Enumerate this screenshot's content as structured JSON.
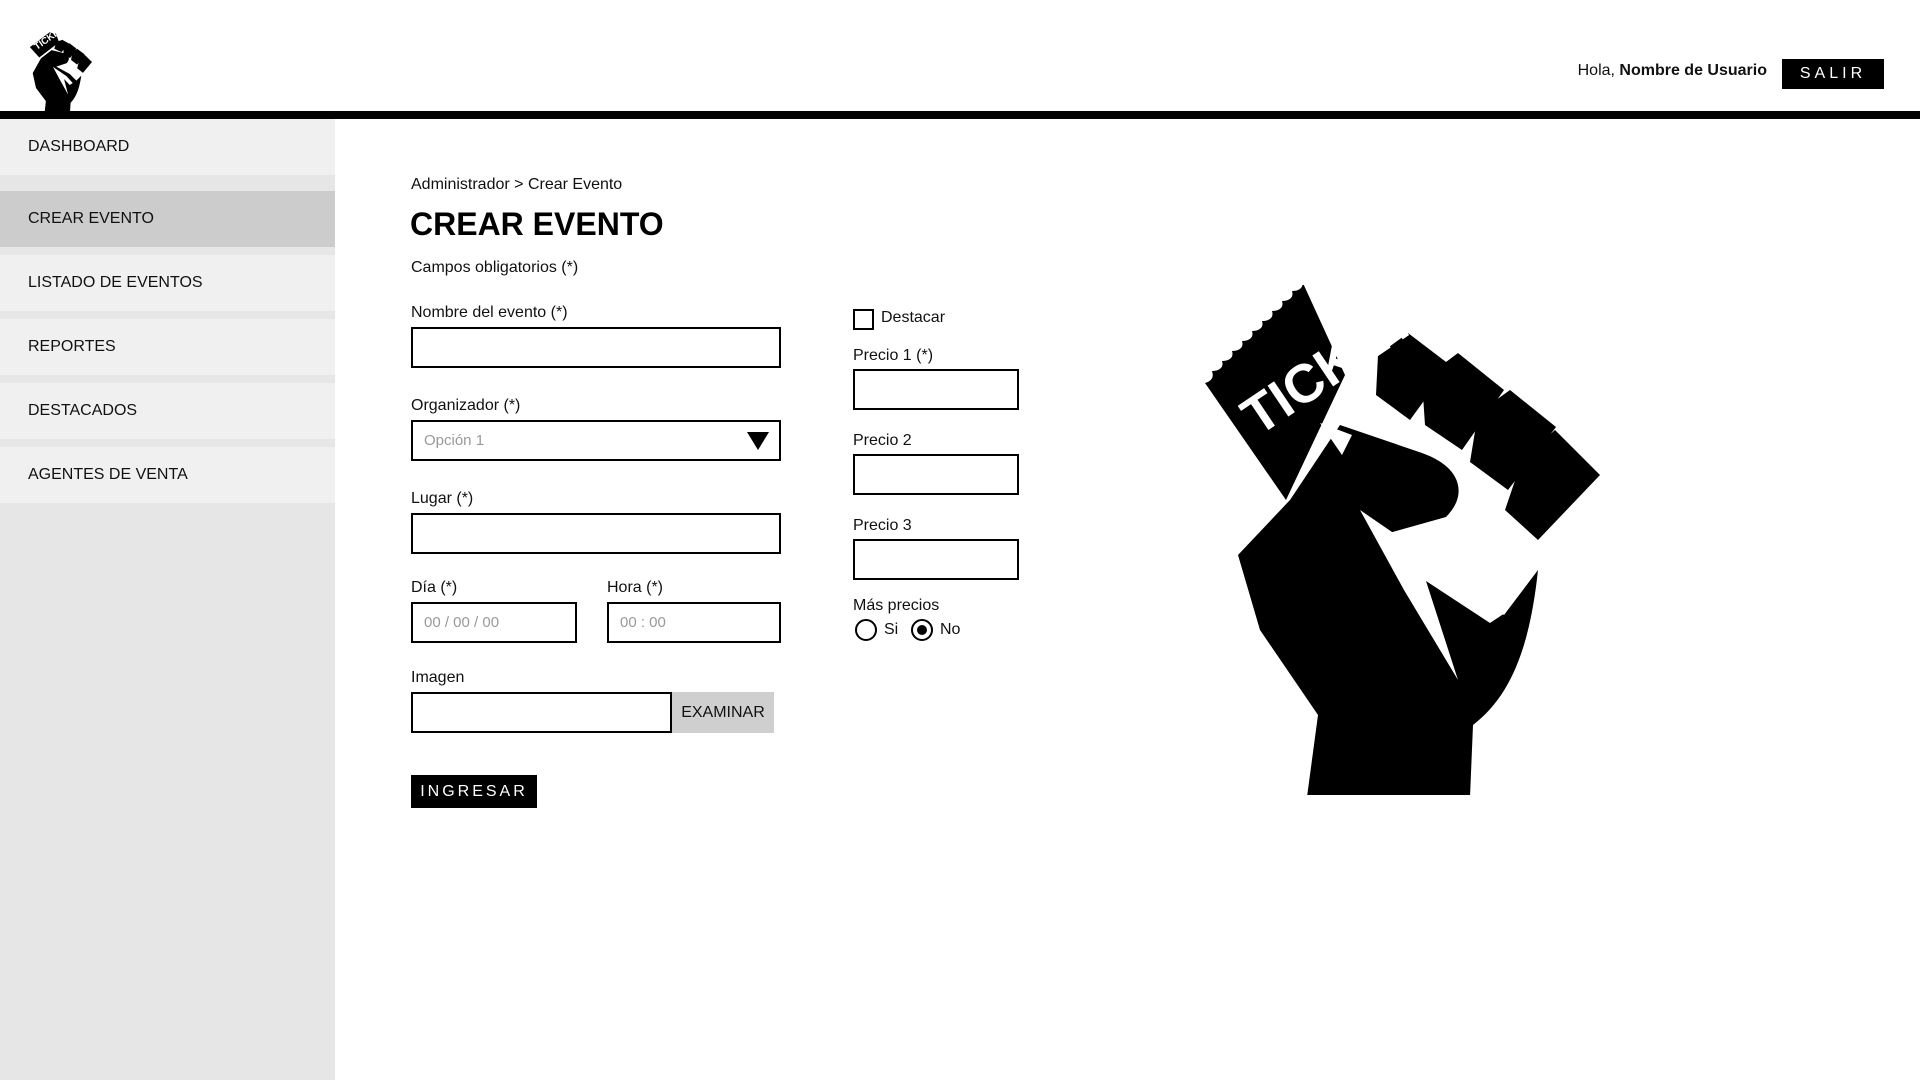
{
  "header": {
    "logo_text": "TICKET",
    "greeting_prefix": "Hola, ",
    "user_name": "Nombre de Usuario",
    "logout_label": "SALIR"
  },
  "sidebar": {
    "items": [
      {
        "label": "DASHBOARD",
        "active": false
      },
      {
        "label": "CREAR EVENTO",
        "active": true
      },
      {
        "label": "LISTADO DE EVENTOS",
        "active": false
      },
      {
        "label": "REPORTES",
        "active": false
      },
      {
        "label": "DESTACADOS",
        "active": false
      },
      {
        "label": "AGENTES DE VENTA",
        "active": false
      }
    ]
  },
  "main": {
    "breadcrumb": "Administrador > Crear Evento",
    "title": "CREAR EVENTO",
    "required_note": "Campos obligatorios (*)",
    "form": {
      "event_name_label": "Nombre del evento (*)",
      "event_name_value": "",
      "organizer_label": "Organizador (*)",
      "organizer_selected": "Opción 1",
      "place_label": "Lugar (*)",
      "place_value": "",
      "day_label": "Día (*)",
      "day_placeholder": "00 / 00 / 00",
      "time_label": "Hora (*)",
      "time_placeholder": "00 : 00",
      "image_label": "Imagen",
      "image_value": "",
      "browse_label": "EXAMINAR",
      "submit_label": "INGRESAR",
      "featured_label": "Destacar",
      "featured_checked": false,
      "price1_label": "Precio 1 (*)",
      "price2_label": "Precio 2",
      "price3_label": "Precio 3",
      "more_prices_label": "Más precios",
      "more_prices_options": [
        {
          "label": "Si",
          "selected": false
        },
        {
          "label": "No",
          "selected": true
        }
      ]
    },
    "hero_text": "TICKET"
  },
  "colors": {
    "black": "#000000",
    "sidebar_bg": "#e6e6e6",
    "sidebar_item_bg": "#f0f0f0",
    "sidebar_active_bg": "#cccccc",
    "browse_bg": "#cfcfcf",
    "placeholder": "#999999"
  },
  "icons": {
    "logo": "fist-ticket-icon",
    "hero": "fist-ticket-illustration",
    "select": "triangle-down-icon"
  }
}
